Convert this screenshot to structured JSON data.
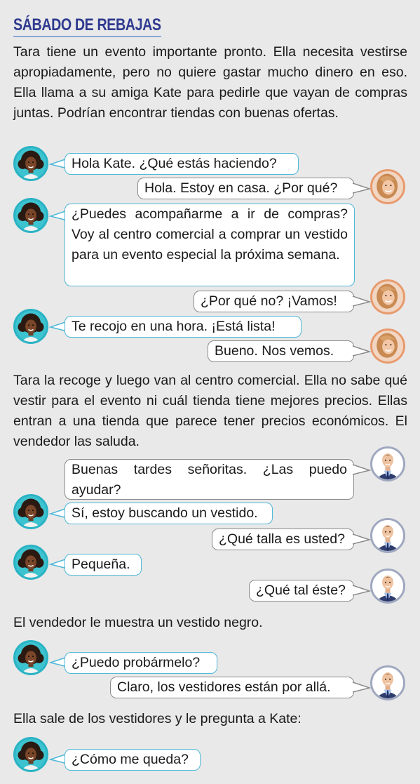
{
  "title": "SÁBADO DE REBAJAS",
  "paragraphs": [
    "Tara tiene un evento importante pronto. Ella necesita vestirse apropiadamente, pero no quiere gastar mucho dinero en eso. Ella llama a su amiga Kate para pedirle que vayan de compras juntas.  Podrían encontrar tiendas con buenas ofertas.",
    "Tara la recoge y luego van al centro comercial. Ella no sabe qué vestir para el evento ni cuál tienda tiene mejores precios. Ellas entran a una tienda que parece tener precios económicos. El vendedor las saluda.",
    "El vendedor le muestra un vestido negro.",
    "Ella sale de los vestidores y le pregunta a Kate:"
  ],
  "dialogue": [
    {
      "speaker": "tara",
      "text": "Hola Kate. ¿Qué estás haciendo?"
    },
    {
      "speaker": "kate",
      "text": "Hola. Estoy en casa. ¿Por qué?"
    },
    {
      "speaker": "tara",
      "text": "¿Puedes acompañarme a ir de compras? Voy al centro comercial a comprar un vestido para un evento especial la próxima semana."
    },
    {
      "speaker": "kate",
      "text": "¿Por qué no? ¡Vamos!"
    },
    {
      "speaker": "tara",
      "text": "Te recojo en una hora. ¡Está lista!"
    },
    {
      "speaker": "kate",
      "text": "Bueno. Nos vemos."
    },
    {
      "speaker": "seller",
      "text": "Buenas tardes señoritas. ¿Las puedo ayudar?"
    },
    {
      "speaker": "tara",
      "text": "Sí, estoy buscando un vestido."
    },
    {
      "speaker": "seller",
      "text": "¿Qué talla es usted?"
    },
    {
      "speaker": "tara",
      "text": "Pequeña."
    },
    {
      "speaker": "seller",
      "text": "¿Qué tal éste?"
    },
    {
      "speaker": "tara",
      "text": "¿Puedo probármelo?"
    },
    {
      "speaker": "seller",
      "text": "Claro, los vestidores están por allá."
    },
    {
      "speaker": "tara",
      "text": "¿Cómo me queda?"
    }
  ],
  "colors": {
    "title": "#2e3a8f",
    "background": "#e9e9e9",
    "left_bubble_border": "#4fb8d8",
    "right_bubble_border": "#8a8a8a"
  },
  "icons": {
    "tara": "woman-curly-hair-avatar-icon",
    "kate": "woman-blonde-avatar-icon",
    "seller": "man-suit-avatar-icon"
  }
}
